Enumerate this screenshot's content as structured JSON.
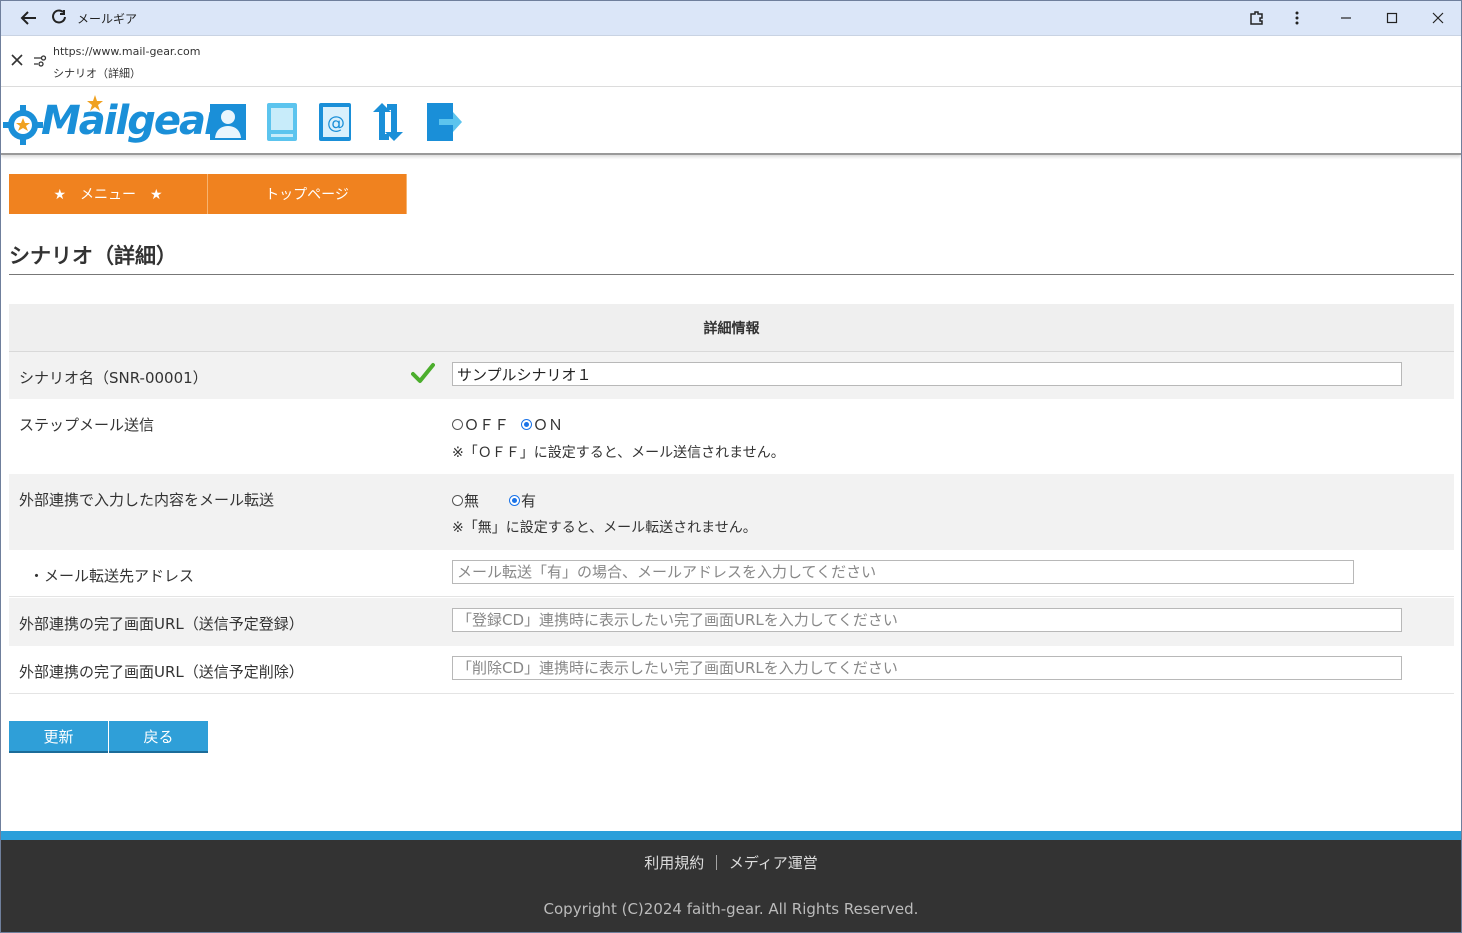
{
  "browser": {
    "window_title": "メールギア",
    "url": "https://www.mail-gear.com",
    "page_title": "シナリオ（詳細）"
  },
  "logo": {
    "text": "Mailgear"
  },
  "header_icons": [
    "user-icon",
    "document-icon",
    "address-book-icon",
    "sync-icon",
    "logout-icon"
  ],
  "menu": {
    "menu_label": "★　メニュー　★",
    "top_label": "トップページ"
  },
  "page": {
    "title": "シナリオ（詳細）"
  },
  "table": {
    "header": "詳細情報",
    "scenario_name_label": "シナリオ名（SNR-00001）",
    "scenario_name_value": "サンプルシナリオ１",
    "step_mail_label": "ステップメール送信",
    "step_off": "ＯＦＦ",
    "step_on": "ＯＮ",
    "step_selected": "ON",
    "step_note": "※「ＯＦＦ」に設定すると、メール送信されません。",
    "forward_label": "外部連携で入力した内容をメール転送",
    "forward_no": "無",
    "forward_yes": "有",
    "forward_selected": "有",
    "forward_note": "※「無」に設定すると、メール転送されません。",
    "forward_addr_label": "・メール転送先アドレス",
    "forward_addr_placeholder": "メール転送「有」の場合、メールアドレスを入力してください",
    "reg_url_label": "外部連携の完了画面URL（送信予定登録）",
    "reg_url_placeholder": "「登録CD」連携時に表示したい完了画面URLを入力してください",
    "del_url_label": "外部連携の完了画面URL（送信予定削除）",
    "del_url_placeholder": "「削除CD」連携時に表示したい完了画面URLを入力してください"
  },
  "buttons": {
    "update": "更新",
    "back": "戻る"
  },
  "footer": {
    "terms": "利用規約",
    "separator": "｜",
    "media": "メディア運営",
    "copyright": "Copyright (C)2024 faith-gear. All Rights Reserved."
  },
  "colors": {
    "menu": "#f0821f",
    "button": "#2f9fd8",
    "footer": "#333333",
    "brand": "#1a8fd8"
  }
}
